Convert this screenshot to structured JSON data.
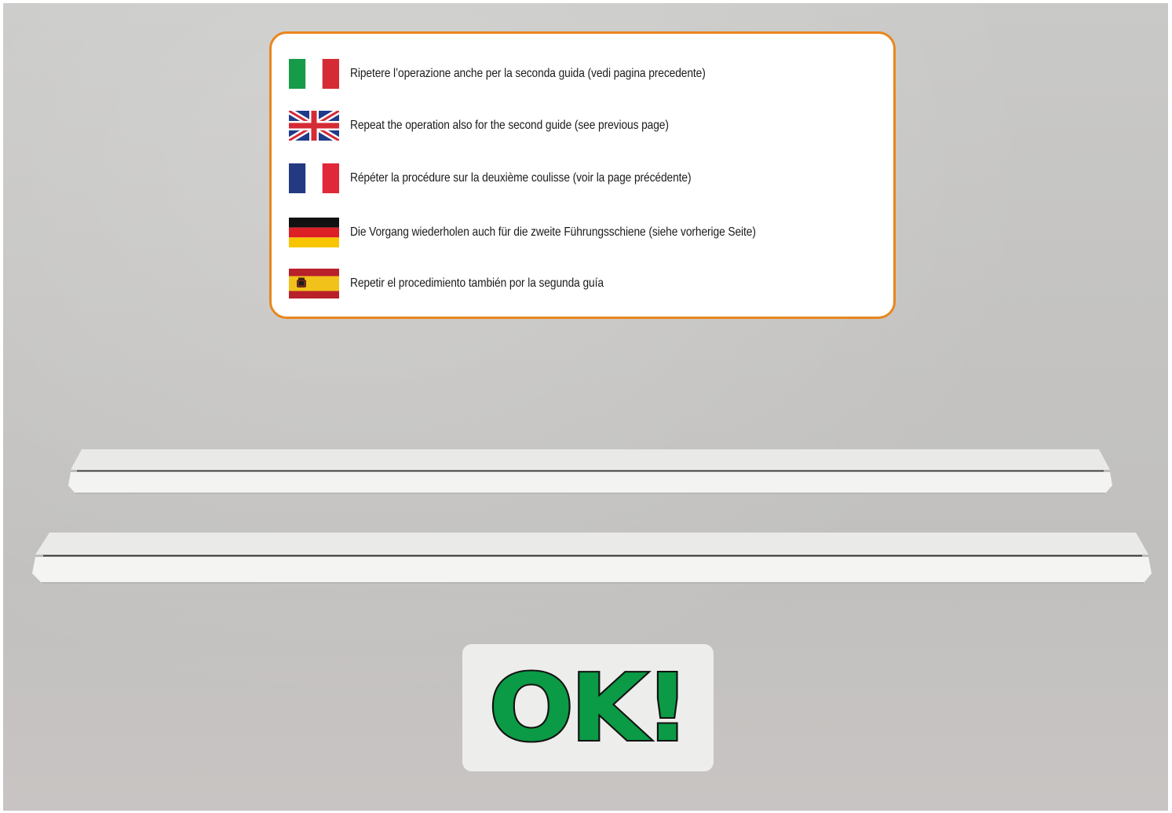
{
  "instructions": [
    {
      "lang": "it",
      "flag_icon": "italy-flag-icon",
      "text": "Ripetere l’operazione anche per la seconda guida (vedi pagina precedente)"
    },
    {
      "lang": "en",
      "flag_icon": "uk-flag-icon",
      "text": "Repeat the operation also for the second guide (see previous page)"
    },
    {
      "lang": "fr",
      "flag_icon": "france-flag-icon",
      "text": "Répéter la procédure sur la deuxième coulisse (voir la page précédente)"
    },
    {
      "lang": "de",
      "flag_icon": "germany-flag-icon",
      "text": "Die Vorgang wiederholen auch für die zweite Führungsschiene (siehe vorherige Seite)"
    },
    {
      "lang": "es",
      "flag_icon": "spain-flag-icon",
      "text": "Repetir el procedimiento también por la segunda guía"
    }
  ],
  "status": {
    "label": "OK!"
  },
  "colors": {
    "box_border": "#e8861c",
    "ok_fill": "#0b9a45",
    "background": "#c5c4c2"
  }
}
